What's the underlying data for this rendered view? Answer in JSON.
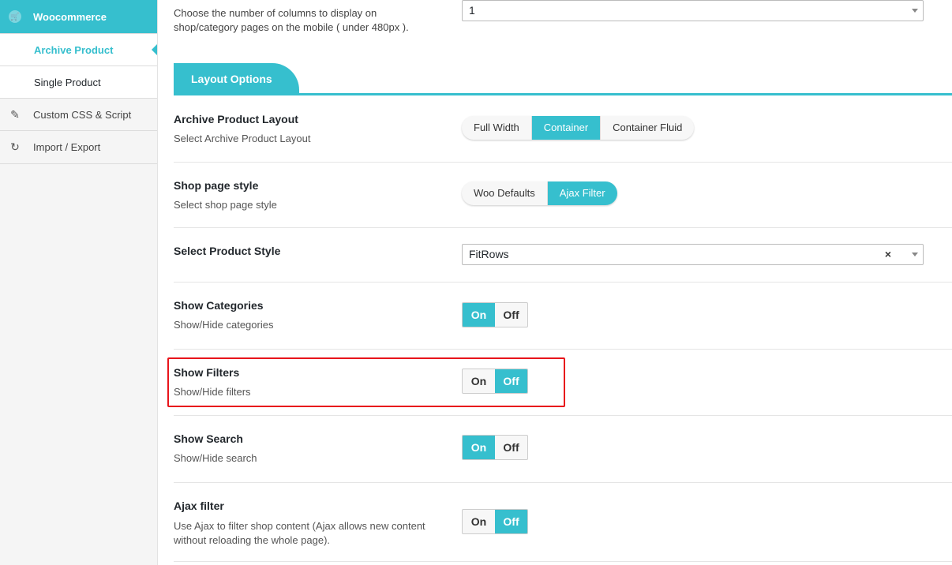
{
  "sidebar": {
    "items": [
      {
        "label": "Woocommerce",
        "icon": "cart-icon"
      },
      {
        "label": "Archive Product"
      },
      {
        "label": "Single Product"
      },
      {
        "label": "Custom CSS & Script",
        "icon": "edit-icon"
      },
      {
        "label": "Import / Export",
        "icon": "refresh-icon"
      }
    ]
  },
  "top": {
    "description": "Choose the number of columns to display on shop/category pages on the mobile ( under 480px ).",
    "select_value": "1"
  },
  "section": {
    "title": "Layout Options"
  },
  "rows": {
    "archive_layout": {
      "title": "Archive Product Layout",
      "desc": "Select Archive Product Layout",
      "options": [
        "Full Width",
        "Container",
        "Container Fluid"
      ],
      "selected": "Container"
    },
    "shop_style": {
      "title": "Shop page style",
      "desc": "Select shop page style",
      "options": [
        "Woo Defaults",
        "Ajax Filter"
      ],
      "selected": "Ajax Filter"
    },
    "product_style": {
      "title": "Select Product Style",
      "value": "FitRows",
      "clear": "×"
    },
    "show_categories": {
      "title": "Show Categories",
      "desc": "Show/Hide categories",
      "on": "On",
      "off": "Off",
      "state": "On"
    },
    "show_filters": {
      "title": "Show Filters",
      "desc": "Show/Hide filters",
      "on": "On",
      "off": "Off",
      "state": "Off"
    },
    "show_search": {
      "title": "Show Search",
      "desc": "Show/Hide search",
      "on": "On",
      "off": "Off",
      "state": "On"
    },
    "ajax_filter": {
      "title": "Ajax filter",
      "desc": "Use Ajax to filter shop content (Ajax allows new content without reloading the whole page).",
      "on": "On",
      "off": "Off",
      "state": "Off"
    }
  },
  "colors": {
    "accent": "#36bfce",
    "highlight": "#e8141b"
  }
}
